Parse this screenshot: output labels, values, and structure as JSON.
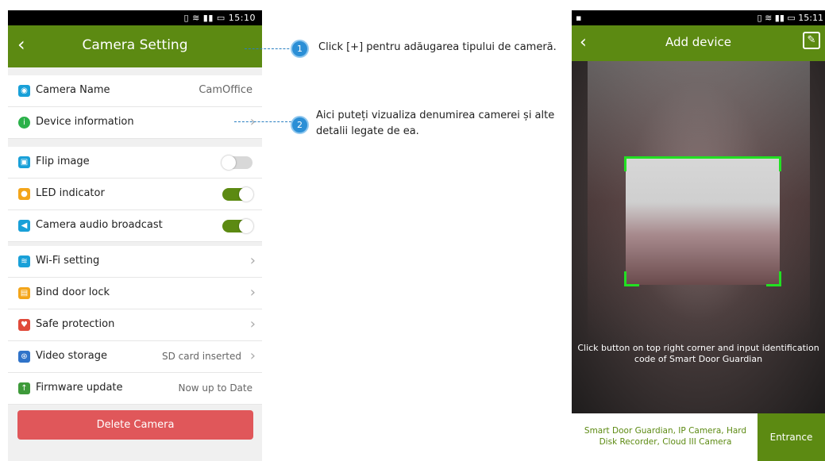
{
  "left_phone": {
    "status_time": "15:10",
    "status_icons": "▯ ≋ ▮▮ ▭",
    "title": "Camera Setting",
    "back_glyph": "‹",
    "camera_name": {
      "label": "Camera Name",
      "value": "CamOffice",
      "icon_color": "#19a0d8"
    },
    "device_information": {
      "label": "Device information",
      "icon_color": "#2bb14a"
    },
    "flip_image": {
      "label": "Flip image",
      "state": "off",
      "icon_color": "#19a0d8"
    },
    "led_indicator": {
      "label": "LED indicator",
      "state": "on",
      "icon_color": "#f3a51a"
    },
    "camera_audio": {
      "label": "Camera audio broadcast",
      "state": "on",
      "icon_color": "#19a0d8"
    },
    "wifi_setting": {
      "label": "Wi-Fi setting",
      "icon_color": "#19a0d8"
    },
    "bind_door_lock": {
      "label": "Bind door lock",
      "icon_color": "#f3a51a"
    },
    "safe_protection": {
      "label": "Safe protection",
      "icon_color": "#e04a3a"
    },
    "video_storage": {
      "label": "Video storage",
      "value": "SD card inserted",
      "icon_color": "#2f73c9"
    },
    "firmware_update": {
      "label": "Firmware update",
      "value": "Now up to Date",
      "icon_color": "#3e9a3a"
    },
    "delete_button": "Delete Camera",
    "accent_color": "#5c8a12",
    "delete_color": "#e0575a"
  },
  "annotations": {
    "note1": {
      "number": "1",
      "text": "Click [+] pentru adăugarea tipului de cameră."
    },
    "note2": {
      "number": "2",
      "line1": "Aici puteți vizualiza denumirea camerei și alte",
      "line2": "detalii legate de ea."
    }
  },
  "right_phone": {
    "status_time": "15:11",
    "status_icons": "▯ ≋ ▮▮ ▭",
    "status_left": "▪",
    "title": "Add device",
    "back_glyph": "‹",
    "edit_glyph": "✎",
    "instruction_line1": "Click button on top right corner and input identification",
    "instruction_line2": "code of Smart Door Guardian",
    "types_line1": "Smart Door Guardian, IP Camera, Hard",
    "types_line2": "Disk Recorder, Cloud III Camera",
    "entrance_button": "Entrance",
    "scan_frame_color": "#22e022"
  }
}
